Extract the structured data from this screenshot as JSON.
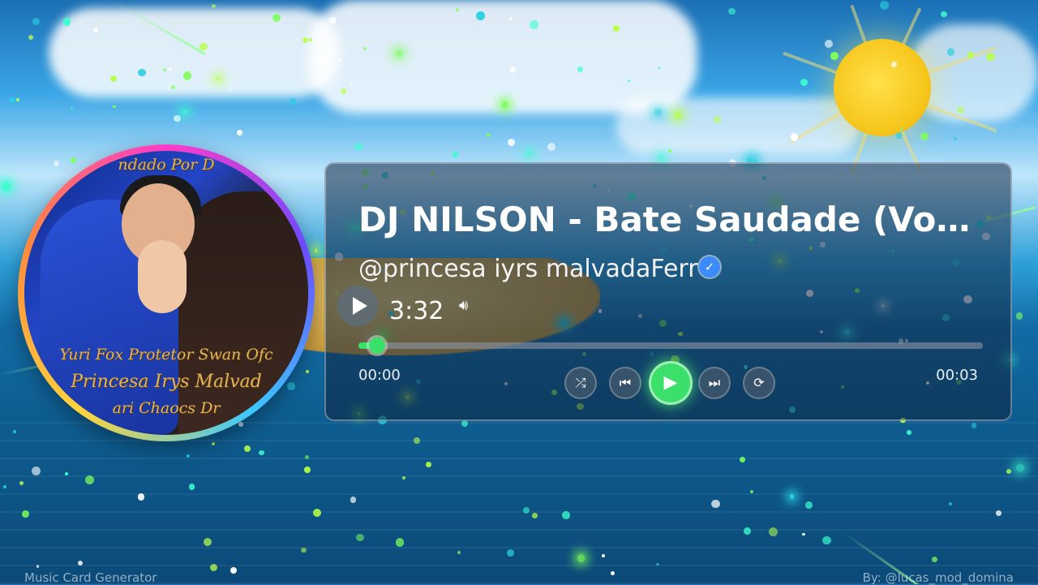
{
  "track": {
    "title": "DJ NILSON - Bate Saudade (Vou C...",
    "artist": "@princesa iyrs malvadaFerr",
    "duration": "3:32",
    "current_time": "00:00",
    "end_time": "00:03",
    "progress_fraction": 0.03
  },
  "album": {
    "overlay_lines": [
      "ndado Por D",
      "Yuri Fox Protetor Swan Ofc",
      "Princesa Irys Malvad",
      "ari Chaocs Dr"
    ]
  },
  "controls": {
    "shuffle_icon": "shuffle-icon",
    "previous_icon": "skip-previous-icon",
    "play_icon": "play-icon",
    "next_icon": "skip-next-icon",
    "repeat_icon": "repeat-icon",
    "accent_color": "#3be06a"
  },
  "footer": {
    "left": "Music Card Generator",
    "right": "By: @lucas_mod_domina"
  }
}
